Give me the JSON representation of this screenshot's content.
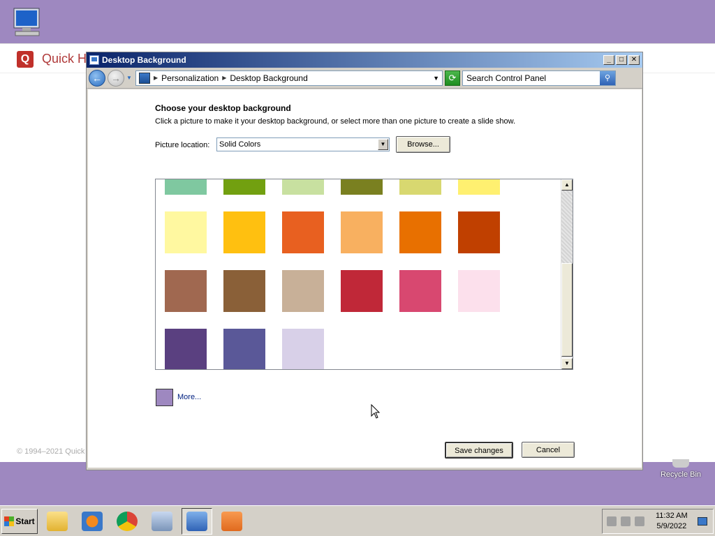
{
  "background_window": {
    "title": "Quick H",
    "logo_letter": "Q",
    "footer": "© 1994–2021 Quick"
  },
  "desktop": {
    "recycle_bin_label": "Recycle Bin"
  },
  "dialog": {
    "title": "Desktop Background",
    "controls": {
      "minimize": "_",
      "maximize": "□",
      "close": "✕"
    },
    "breadcrumb": [
      "Personalization",
      "Desktop Background"
    ],
    "search_placeholder": "Search Control Panel",
    "heading": "Choose your desktop background",
    "instructions": "Click a picture to make it your desktop background, or select more than one picture to create a slide show.",
    "picture_location_label": "Picture location:",
    "picture_location_value": "Solid Colors",
    "browse_label": "Browse...",
    "more_label": "More...",
    "more_color": "#9e88c0",
    "save_label": "Save changes",
    "cancel_label": "Cancel",
    "swatches": [
      "#7fc8a0",
      "#72a010",
      "#c8e0a0",
      "#7a8020",
      "#d8d870",
      "#fff070",
      "#fff8a0",
      "#ffc010",
      "#e86020",
      "#f8b060",
      "#e87000",
      "#c04000",
      "#a06850",
      "#8a6038",
      "#c8b098",
      "#c02838",
      "#d84870",
      "#fce0ec",
      "#5a4080",
      "#5a5898",
      "#d8d0e8"
    ]
  },
  "taskbar": {
    "start_label": "Start",
    "time": "11:32 AM",
    "date": "5/9/2022"
  }
}
